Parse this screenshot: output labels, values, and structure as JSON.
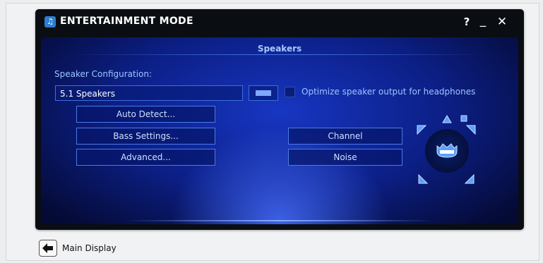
{
  "window": {
    "title": "ENTERTAINMENT MODE",
    "icon_glyph": "♫",
    "help_label": "?",
    "minimize_label": "_",
    "close_label": "✕"
  },
  "panel": {
    "section_title": "Speakers",
    "config_label": "Speaker Configuration:",
    "config_value": "5.1 Speakers",
    "optimize_label": "Optimize speaker output for headphones",
    "optimize_checked": false
  },
  "buttons": {
    "auto_detect": "Auto Detect...",
    "bass_settings": "Bass Settings...",
    "advanced": "Advanced...",
    "channel": "Channel",
    "noise": "Noise"
  },
  "footer": {
    "back_label": "Main Display"
  },
  "colors": {
    "panel_accent": "#1736c2",
    "label_text": "#9ec6ff",
    "speaker_icon": "#5aa0ff"
  },
  "icons": [
    "app-icon",
    "listener-icon",
    "speaker-icon",
    "back-arrow-icon"
  ]
}
